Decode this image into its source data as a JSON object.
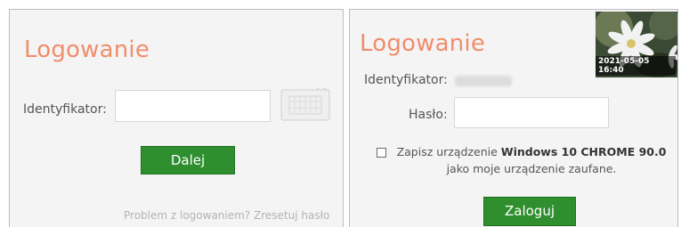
{
  "left_panel": {
    "title": "Logowanie",
    "identifier_label": "Identyfikator:",
    "identifier_value": "",
    "next_button": "Dalej",
    "reset_link": "Problem z logowaniem? Zresetuj hasło",
    "keyboard_icon": "keyboard-icon"
  },
  "right_panel": {
    "title": "Logowanie",
    "identifier_label": "Identyfikator:",
    "password_label": "Hasło:",
    "password_value": "",
    "remember_prefix": "Zapisz urządzenie ",
    "remember_device": "Windows 10 CHROME 90.0",
    "remember_suffix": "jako moje urządzenie zaufane.",
    "remember_checked": false,
    "login_button": "Zaloguj",
    "security_image_timestamp": "2021-05-05 16:40"
  },
  "colors": {
    "title": "#f08d6b",
    "button": "#2f8f2f",
    "panel_bg": "#f4f4f4"
  }
}
